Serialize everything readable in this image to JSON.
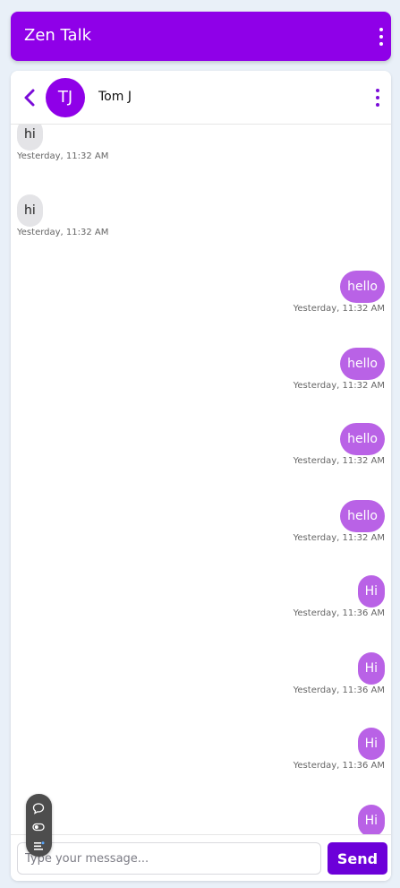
{
  "app": {
    "title": "Zen Talk"
  },
  "chat": {
    "contact_initials": "TJ",
    "contact_name": "Tom J"
  },
  "messages": [
    {
      "direction": "received",
      "text": "hi",
      "time": "Yesterday, 11:32 AM"
    },
    {
      "direction": "received",
      "text": "hi",
      "time": "Yesterday, 11:32 AM"
    },
    {
      "direction": "sent",
      "text": "hello",
      "time": "Yesterday, 11:32 AM"
    },
    {
      "direction": "sent",
      "text": "hello",
      "time": "Yesterday, 11:32 AM"
    },
    {
      "direction": "sent",
      "text": "hello",
      "time": "Yesterday, 11:32 AM"
    },
    {
      "direction": "sent",
      "text": "hello",
      "time": "Yesterday, 11:32 AM"
    },
    {
      "direction": "sent",
      "text": "Hi",
      "time": "Yesterday, 11:36 AM"
    },
    {
      "direction": "sent",
      "text": "Hi",
      "time": "Yesterday, 11:36 AM"
    },
    {
      "direction": "sent",
      "text": "Hi",
      "time": "Yesterday, 11:36 AM"
    },
    {
      "direction": "sent",
      "text": "Hi",
      "time": ""
    }
  ],
  "composer": {
    "placeholder": "Type your message...",
    "value": "",
    "send_label": "Send"
  },
  "icons": {
    "back": "chevron-left-icon",
    "app_menu": "more-vertical-icon",
    "chat_menu": "more-vertical-icon",
    "toolbar": [
      "chat-bubble-icon",
      "toggle-icon",
      "list-icon"
    ]
  },
  "colors": {
    "brand": "#8f00e8",
    "sent_bubble": "#b962e6",
    "received_bubble": "#e4e4e7",
    "send_button": "#6c00d9",
    "background": "#e9f0f8"
  }
}
